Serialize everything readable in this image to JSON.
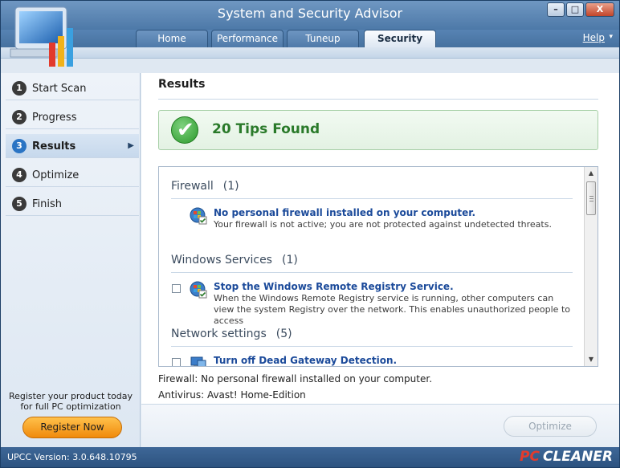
{
  "window": {
    "title": "System and Security Advisor",
    "controls": {
      "minimize": "–",
      "maximize": "□",
      "close": "X"
    }
  },
  "tabs": [
    {
      "label": "Home",
      "active": false
    },
    {
      "label": "Performance",
      "active": false
    },
    {
      "label": "Tuneup",
      "active": false
    },
    {
      "label": "Security",
      "active": true
    }
  ],
  "help": {
    "label": "Help",
    "arrow": "▾"
  },
  "steps": [
    {
      "num": "1",
      "label": "Start Scan",
      "active": false
    },
    {
      "num": "2",
      "label": "Progress",
      "active": false
    },
    {
      "num": "3",
      "label": "Results",
      "active": true
    },
    {
      "num": "4",
      "label": "Optimize",
      "active": false
    },
    {
      "num": "5",
      "label": "Finish",
      "active": false
    }
  ],
  "promo": {
    "line1": "Register your product today",
    "line2": "for full PC optimization",
    "button": "Register Now"
  },
  "results": {
    "heading": "Results",
    "summary": "20 Tips Found",
    "groups": [
      {
        "title": "Firewall",
        "count": "(1)",
        "items": [
          {
            "title": "No personal firewall installed on your computer.",
            "desc": "Your firewall is not active; you are not protected against undetected threats.",
            "checkbox": false
          }
        ]
      },
      {
        "title": "Windows Services",
        "count": "(1)",
        "items": [
          {
            "title": "Stop the Windows Remote Registry Service.",
            "desc": "When the Windows Remote Registry service is running, other computers can view the system Registry over the network. This enables unauthorized people to access",
            "checkbox": true,
            "checked": false
          }
        ]
      },
      {
        "title": "Network settings",
        "count": "(5)",
        "items": [
          {
            "title": "Turn off Dead Gateway Detection.",
            "desc": "",
            "checkbox": true,
            "checked": false
          }
        ]
      }
    ],
    "status_lines": [
      "Firewall: No personal firewall installed on your computer.",
      "Antivirus: Avast! Home-Edition"
    ],
    "optimize_button": "Optimize",
    "optimize_enabled": false
  },
  "footer": {
    "version": "UPCC Version: 3.0.648.10795",
    "brand_pc": "PC",
    "brand_name": "CLEANER"
  },
  "colors": {
    "accent": "#2a74c4",
    "success": "#2a7a2a",
    "link": "#1b4a9a",
    "register": "#f08a0c"
  }
}
